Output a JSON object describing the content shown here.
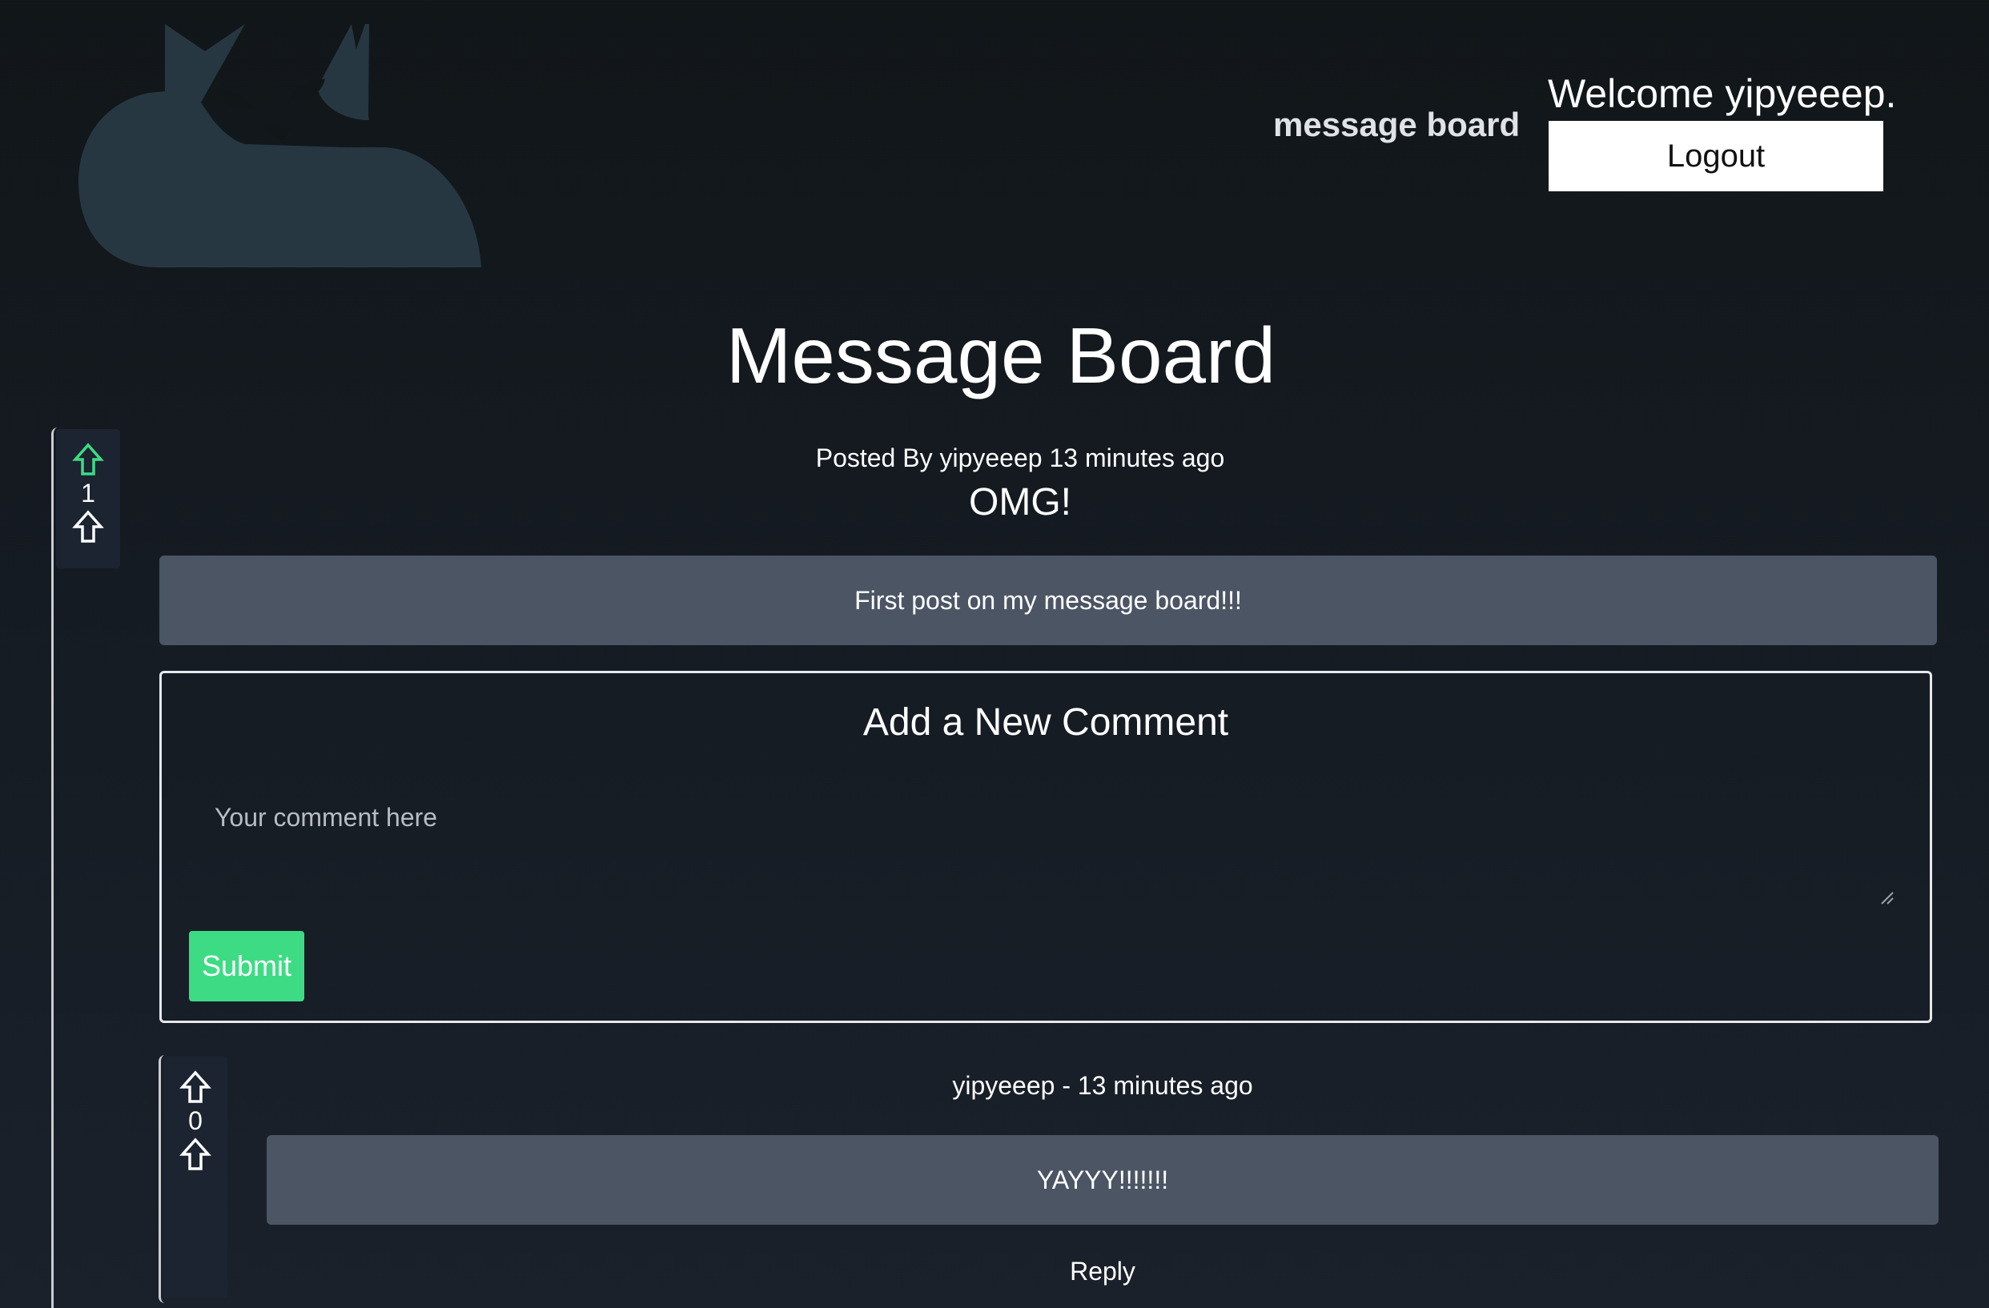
{
  "header": {
    "nav_link": "message board",
    "welcome_text": "Welcome yipyeeep.",
    "logout_label": "Logout"
  },
  "page_title": "Message Board",
  "post": {
    "votes": "1",
    "meta": "Posted By yipyeeep 13 minutes ago",
    "title": "OMG!",
    "body": "First post on my message board!!!"
  },
  "comment_form": {
    "title": "Add a New Comment",
    "placeholder": "Your comment here",
    "submit_label": "Submit"
  },
  "comments": [
    {
      "votes": "0",
      "meta": "yipyeeep - 13 minutes ago",
      "body": "YAYYY!!!!!!!",
      "reply_label": "Reply"
    }
  ],
  "colors": {
    "accent_green": "#3ddc84",
    "card_gray": "#4b5564",
    "logo_slate": "#273741"
  },
  "icons": {
    "upvote": "arrow-up-icon",
    "downvote": "arrow-up-icon",
    "logo": "fox-logo"
  }
}
